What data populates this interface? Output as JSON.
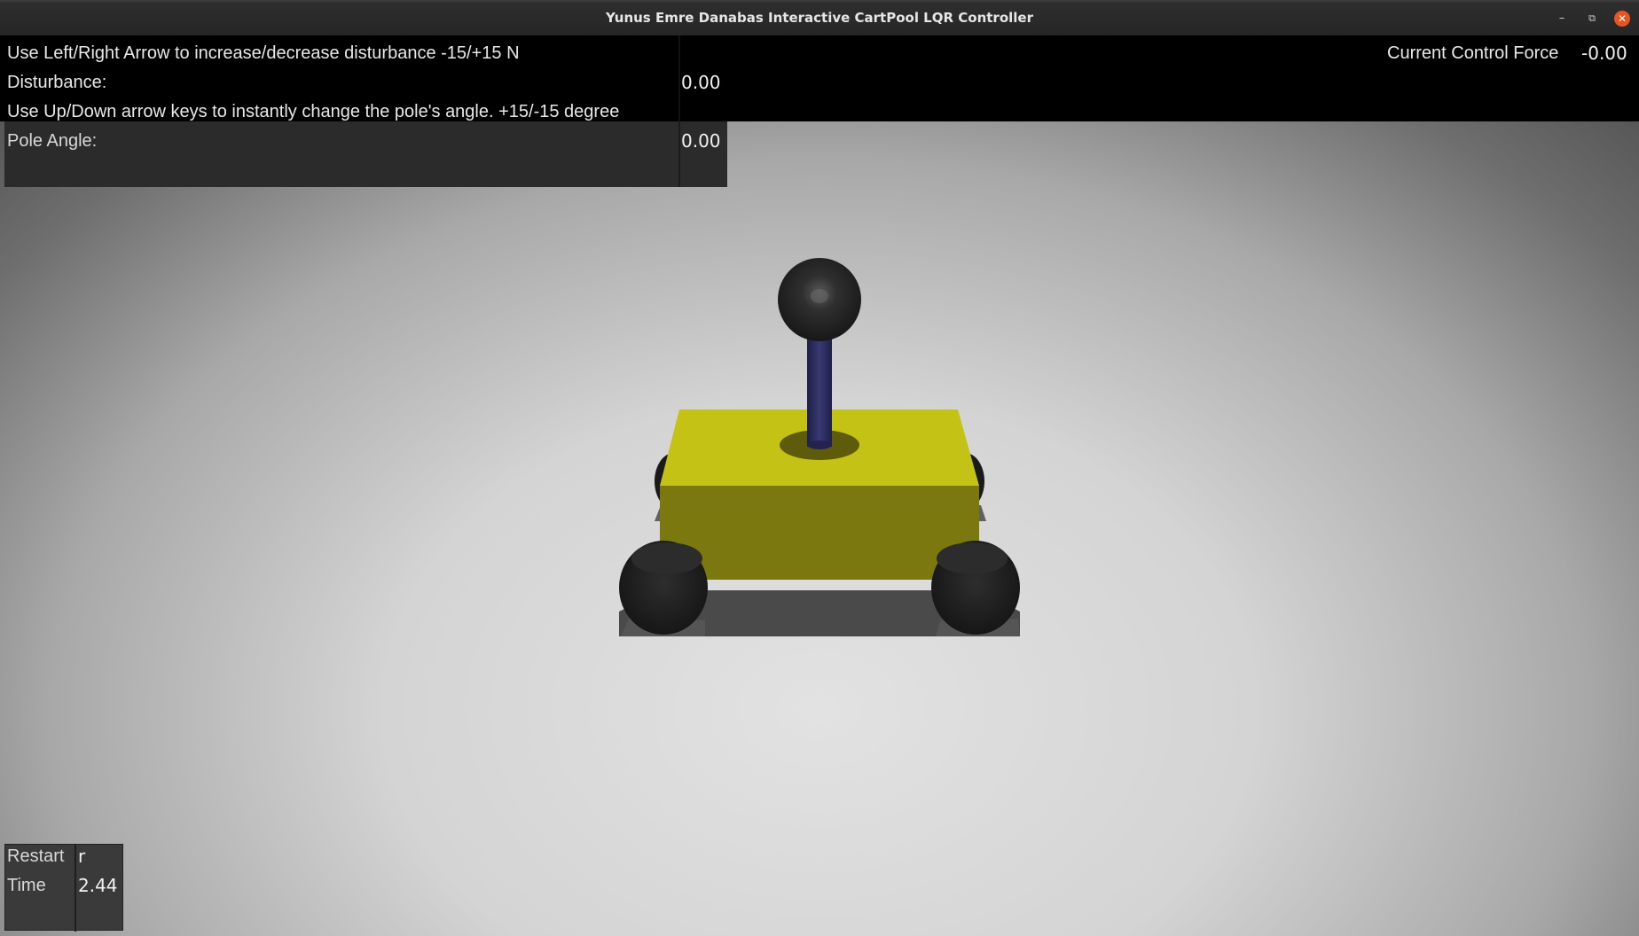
{
  "window": {
    "title": "Yunus Emre Danabas Interactive CartPool LQR Controller",
    "minimize_glyph": "–",
    "maximize_glyph": "⧉",
    "close_glyph": "✕"
  },
  "hud": {
    "disturbance_instruction": "Use Left/Right Arrow to increase/decrease disturbance -15/+15 N",
    "disturbance_label": "Disturbance:",
    "disturbance_value": "0.00",
    "angle_instruction": "Use Up/Down arrow keys to instantly change the pole's angle. +15/-15 degree",
    "pole_angle_label": "Pole Angle:",
    "pole_angle_value": "0.00",
    "control_force_label": "Current Control Force",
    "control_force_value": "-0.00"
  },
  "footer": {
    "restart_label": "Restart",
    "restart_key": "r",
    "time_label": "Time",
    "time_value": "2.44"
  },
  "colors": {
    "cart_top": "#c4c215",
    "cart_front": "#7a780e",
    "pole": "#2c2c5a",
    "ball": "#2a2a2a",
    "wheel": "#1f1f1f"
  }
}
